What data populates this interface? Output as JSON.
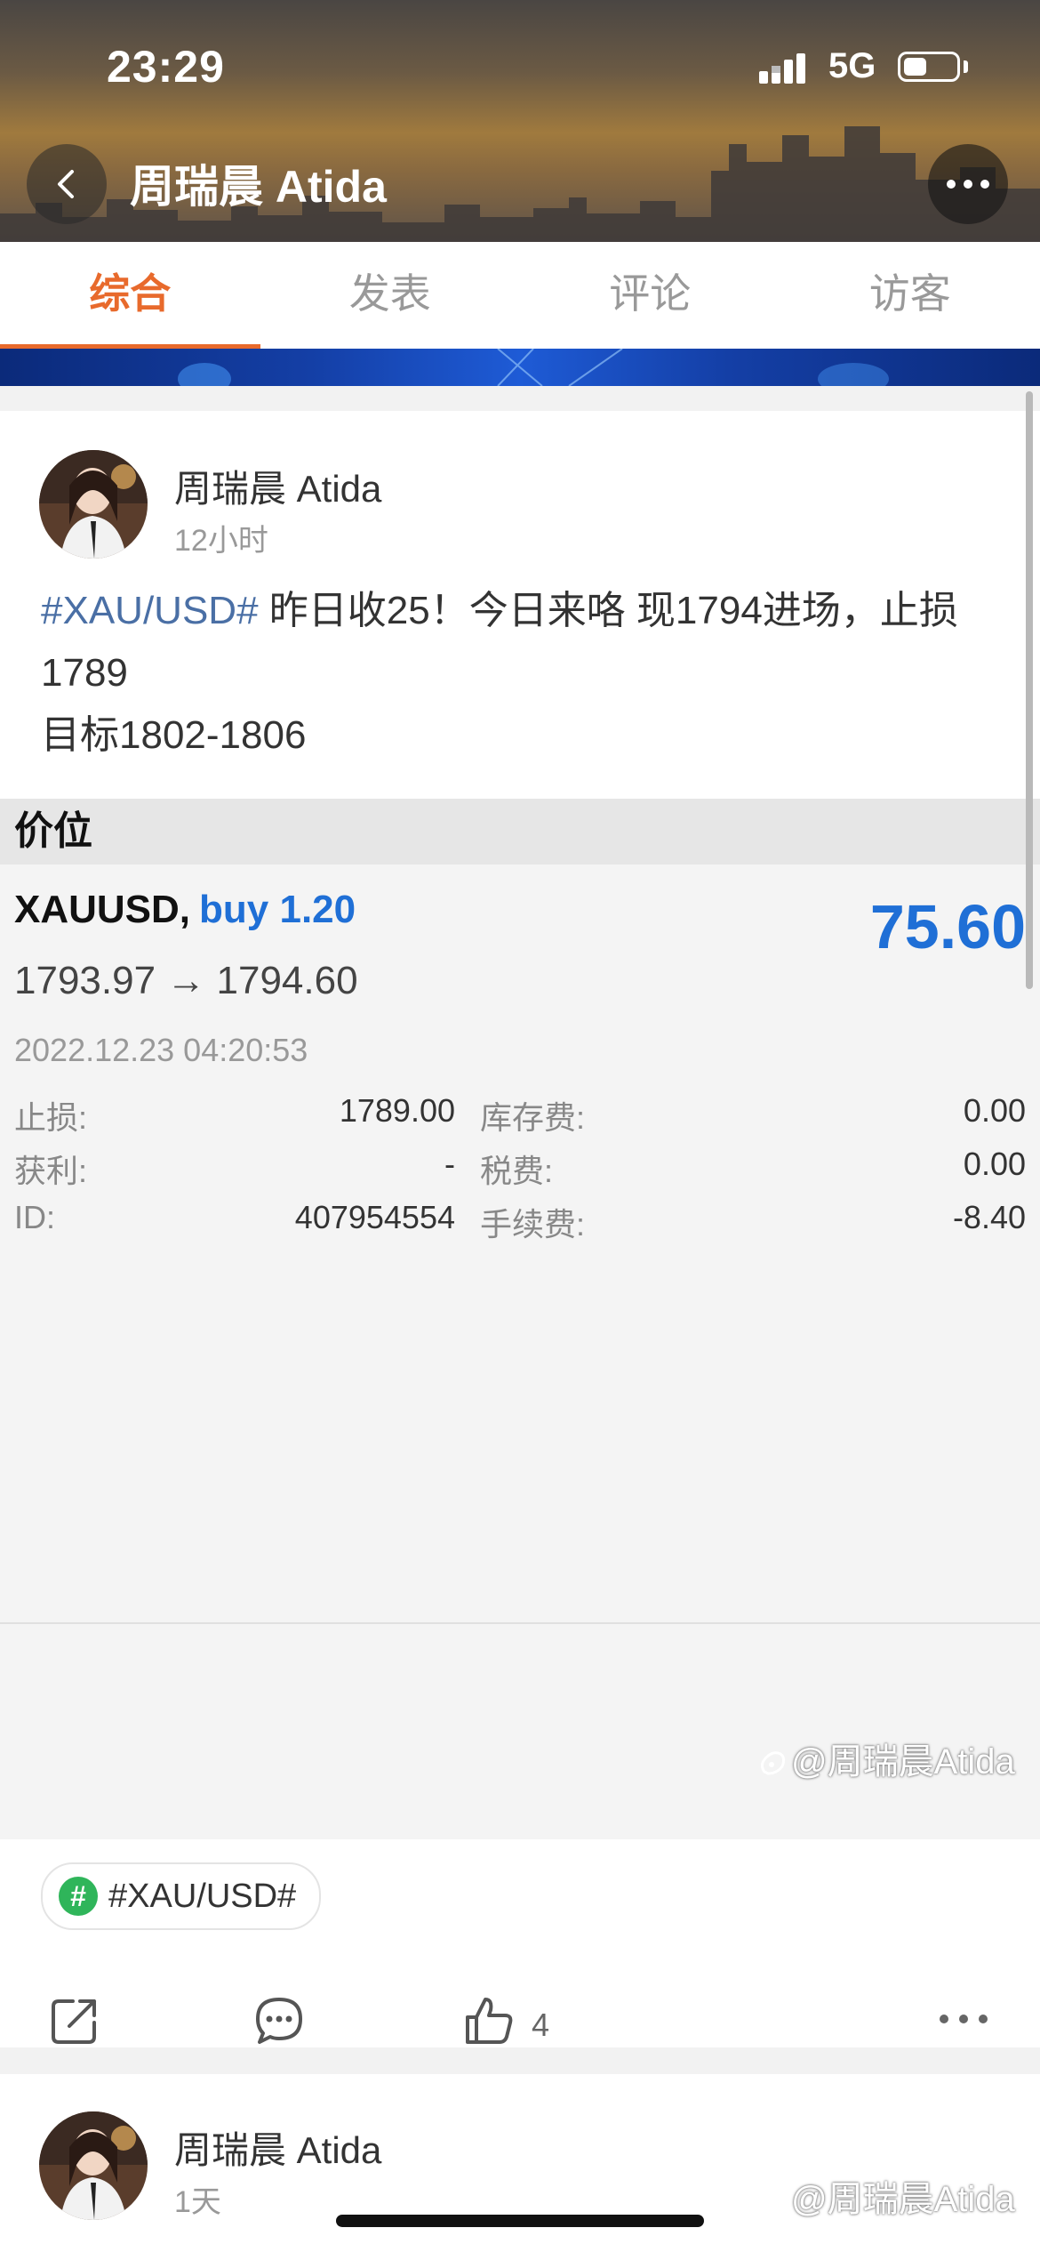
{
  "status_bar": {
    "time": "23:29",
    "network": "5G",
    "battery_level": 0.45
  },
  "nav": {
    "title": "周瑞晨 Atida",
    "back_icon": "chevron-left-icon",
    "more_icon": "ellipsis-icon"
  },
  "tabs": [
    {
      "label": "综合",
      "active": true
    },
    {
      "label": "发表",
      "active": false
    },
    {
      "label": "评论",
      "active": false
    },
    {
      "label": "访客",
      "active": false
    }
  ],
  "post": {
    "author": "周瑞晨 Atida",
    "time": "12小时",
    "hashtag": "#XAU/USD#",
    "text_line1": " 昨日收25！今日来咯 现1794进场，止损1789",
    "text_line2": "目标1802-1806",
    "screenshot": {
      "header": "价位",
      "symbol": "XAUUSD,",
      "side": "buy 1.20",
      "prices": "1793.97 → 1794.60",
      "profit": "75.60",
      "timestamp": "2022.12.23 04:20:53",
      "rows": [
        {
          "l_label": "止损:",
          "l_value": "1789.00",
          "r_label": "库存费:",
          "r_value": "0.00"
        },
        {
          "l_label": "获利:",
          "l_value": "-",
          "r_label": "税费:",
          "r_value": "0.00"
        },
        {
          "l_label": "ID:",
          "l_value": "407954554",
          "r_label": "手续费:",
          "r_value": "-8.40"
        }
      ],
      "accent_color": "#1f6fd6"
    },
    "watermark": "@周瑞晨Atida",
    "topic_tag": "#XAU/USD#",
    "likes": "4"
  },
  "post2": {
    "author": "周瑞晨 Atida",
    "time": "1天",
    "watermark": "@周瑞晨Atida"
  },
  "colors": {
    "tab_active": "#e86a2c",
    "hashtag": "#4a6fa5",
    "topic_badge": "#2fb55a"
  }
}
